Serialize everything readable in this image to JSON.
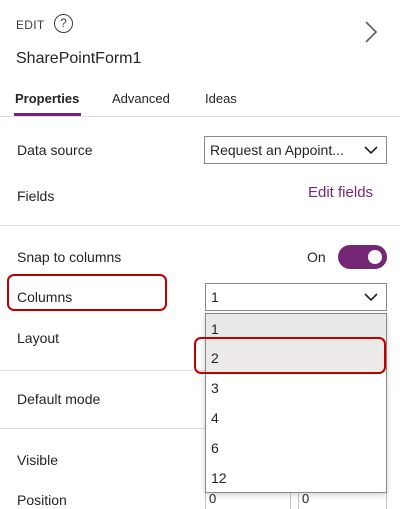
{
  "header": {
    "edit_label": "EDIT",
    "help_glyph": "?",
    "form_name": "SharePointForm1"
  },
  "tabs": [
    {
      "label": "Properties",
      "active": true
    },
    {
      "label": "Advanced",
      "active": false
    },
    {
      "label": "Ideas",
      "active": false
    }
  ],
  "properties": {
    "data_source": {
      "label": "Data source",
      "value": "Request an Appoint..."
    },
    "fields": {
      "label": "Fields",
      "link": "Edit fields"
    },
    "snap_to_columns": {
      "label": "Snap to columns",
      "state_label": "On",
      "on": true
    },
    "columns": {
      "label": "Columns",
      "value": "1",
      "options": [
        "1",
        "2",
        "3",
        "4",
        "6",
        "12"
      ],
      "highlighted_option": "2"
    },
    "layout": {
      "label": "Layout"
    },
    "default_mode": {
      "label": "Default mode"
    },
    "visible": {
      "label": "Visible"
    },
    "position": {
      "label": "Position",
      "x": "0",
      "y": "0"
    }
  },
  "colors": {
    "accent": "#742774",
    "highlight": "#c00000"
  },
  "icons": [
    "help-icon",
    "chevron-right-icon",
    "chevron-down-icon"
  ]
}
